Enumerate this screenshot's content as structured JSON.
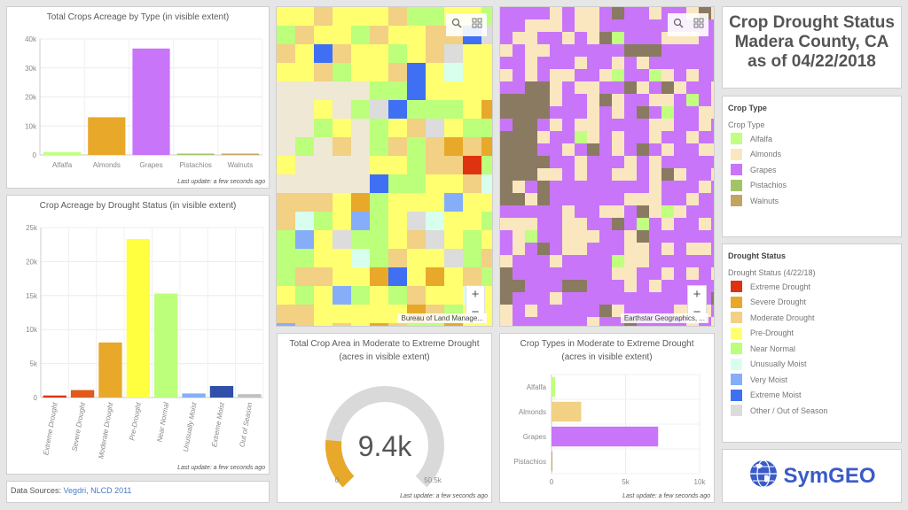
{
  "title_panel": {
    "line1": "Crop Drought Status",
    "line2": "Madera County, CA",
    "line3": "as of 04/22/2018"
  },
  "last_update": "Last update: a few seconds ago",
  "data_sources": {
    "label": "Data Sources:",
    "link": "Vegdri, NLCD 2011"
  },
  "logo": {
    "text": "SymGEO",
    "color": "#3a5bc7"
  },
  "maps": [
    {
      "name": "drought-map",
      "attribution": "Bureau of Land Manage...",
      "tools": [
        "search-icon",
        "basemap-gallery-icon"
      ],
      "zoom_in": "+",
      "zoom_out": "−"
    },
    {
      "name": "crop-map",
      "attribution": "Earthstar Geographics, ...",
      "tools": [
        "search-icon",
        "basemap-gallery-icon"
      ],
      "zoom_in": "+",
      "zoom_out": "−"
    }
  ],
  "legend_crop": {
    "title": "Crop Type",
    "subtitle": "Crop Type",
    "items": [
      {
        "label": "Alfalfa",
        "color": "#c0ff80"
      },
      {
        "label": "Almonds",
        "color": "#fae7c0"
      },
      {
        "label": "Grapes",
        "color": "#c875fa"
      },
      {
        "label": "Pistachios",
        "color": "#a3c466"
      },
      {
        "label": "Walnuts",
        "color": "#c2a464"
      }
    ]
  },
  "legend_drought": {
    "title": "Drought Status",
    "subtitle": "Drought Status (4/22/18)",
    "items": [
      {
        "label": "Extreme Drought",
        "color": "#dd3311"
      },
      {
        "label": "Severe Drought",
        "color": "#e8a82a"
      },
      {
        "label": "Moderate Drought",
        "color": "#f2d084"
      },
      {
        "label": "Pre-Drought",
        "color": "#ffff70"
      },
      {
        "label": "Near Normal",
        "color": "#bcff7a"
      },
      {
        "label": "Unusually Moist",
        "color": "#d8ffee"
      },
      {
        "label": "Very Moist",
        "color": "#86aef8"
      },
      {
        "label": "Extreme Moist",
        "color": "#3f6ff3"
      },
      {
        "label": "Other / Out of Season",
        "color": "#dcdcdc"
      }
    ]
  },
  "chart_data": [
    {
      "id": "crops-by-type",
      "type": "bar",
      "title": "Total Crops Acreage by Type (in visible extent)",
      "categories": [
        "Alfalfa",
        "Almonds",
        "Grapes",
        "Pistachios",
        "Walnuts"
      ],
      "values": [
        1000,
        13000,
        36700,
        100,
        100
      ],
      "colors": [
        "#c0ff80",
        "#e8a82a",
        "#c875fa",
        "#a3c466",
        "#c2a464"
      ],
      "ylim": [
        0,
        40000
      ],
      "yticks": [
        0,
        10000,
        20000,
        30000,
        40000
      ],
      "ytick_labels": [
        "0",
        "10k",
        "20k",
        "30k",
        "40k"
      ],
      "xlabel": "",
      "ylabel": "",
      "grid": true
    },
    {
      "id": "crops-by-drought",
      "type": "bar",
      "title": "Crop Acreage by Drought Status (in visible extent)",
      "categories": [
        "Extreme Drought",
        "Severe Drought",
        "Moderate Drought",
        "Pre-Drought",
        "Near Normal",
        "Unusually Moist",
        "Extreme Moist",
        "Out of Season"
      ],
      "values": [
        300,
        1100,
        8100,
        23300,
        15300,
        600,
        1700,
        500
      ],
      "colors": [
        "#dd3311",
        "#e05a1a",
        "#e8a82a",
        "#ffff40",
        "#bcff7a",
        "#86aef8",
        "#2f4fa8",
        "#c0c0c0"
      ],
      "ylim": [
        0,
        25000
      ],
      "yticks": [
        0,
        5000,
        10000,
        15000,
        20000,
        25000
      ],
      "ytick_labels": [
        "0",
        "5k",
        "10k",
        "15k",
        "20k",
        "25k"
      ],
      "xlabel": "",
      "ylabel": "",
      "grid": true
    },
    {
      "id": "drought-gauge",
      "type": "gauge",
      "title": "Total Crop Area in Moderate to Extreme Drought",
      "subtitle": "(acres in visible extent)",
      "value": 9400,
      "value_label": "9.4k",
      "min": 0,
      "max": 50500,
      "min_label": "0",
      "max_label": "50.5k",
      "fill_color": "#e8a82a",
      "track_color": "#d9d9d9"
    },
    {
      "id": "crops-in-drought",
      "type": "bar",
      "orientation": "horizontal",
      "title": "Crop Types in Moderate to Extreme Drought",
      "subtitle": "(acres in visible extent)",
      "categories": [
        "Alfalfa",
        "Almonds",
        "Grapes",
        "Pistachios"
      ],
      "values": [
        240,
        2000,
        7200,
        50
      ],
      "colors": [
        "#c0ff80",
        "#f2d084",
        "#c875fa",
        "#c2a464"
      ],
      "xlim": [
        0,
        10000
      ],
      "xticks": [
        0,
        5000,
        10000
      ],
      "xtick_labels": [
        "0",
        "5k",
        "10k"
      ],
      "grid": true
    }
  ]
}
